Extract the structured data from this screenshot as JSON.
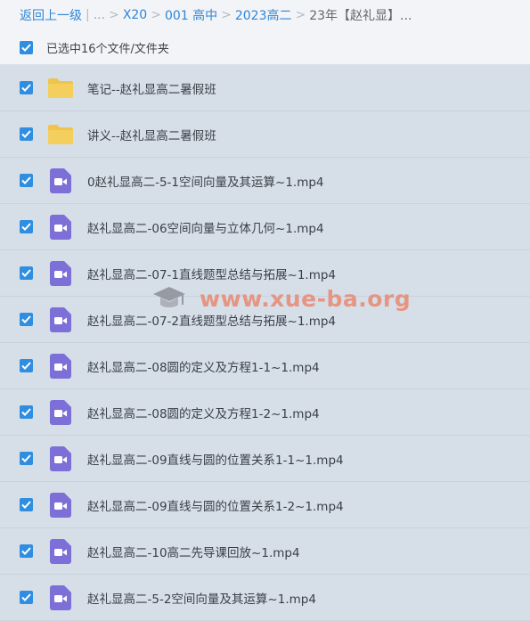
{
  "breadcrumb": {
    "back": "返回上一级",
    "divider": "|",
    "ellipsis": "...",
    "crumbs": [
      "X20",
      "001 高中",
      "2023高二"
    ],
    "current": "23年【赵礼显】..."
  },
  "selection": {
    "label": "已选中16个文件/文件夹"
  },
  "files": [
    {
      "name": "笔记--赵礼显高二暑假班",
      "type": "folder"
    },
    {
      "name": "讲义--赵礼显高二暑假班",
      "type": "folder"
    },
    {
      "name": "0赵礼显高二-5-1空间向量及其运算~1.mp4",
      "type": "video"
    },
    {
      "name": "赵礼显高二-06空间向量与立体几何~1.mp4",
      "type": "video"
    },
    {
      "name": "赵礼显高二-07-1直线题型总结与拓展~1.mp4",
      "type": "video"
    },
    {
      "name": "赵礼显高二-07-2直线题型总结与拓展~1.mp4",
      "type": "video"
    },
    {
      "name": "赵礼显高二-08圆的定义及方程1-1~1.mp4",
      "type": "video"
    },
    {
      "name": "赵礼显高二-08圆的定义及方程1-2~1.mp4",
      "type": "video"
    },
    {
      "name": "赵礼显高二-09直线与圆的位置关系1-1~1.mp4",
      "type": "video"
    },
    {
      "name": "赵礼显高二-09直线与圆的位置关系1-2~1.mp4",
      "type": "video"
    },
    {
      "name": "赵礼显高二-10高二先导课回放~1.mp4",
      "type": "video"
    },
    {
      "name": "赵礼显高二-5-2空间向量及其运算~1.mp4",
      "type": "video"
    }
  ],
  "watermark": {
    "text": "www.xue-ba.org"
  },
  "colors": {
    "accent": "#2f8ee0",
    "folder": "#f0c44c",
    "video": "#7d6fd8",
    "watermark": "#e88970"
  }
}
